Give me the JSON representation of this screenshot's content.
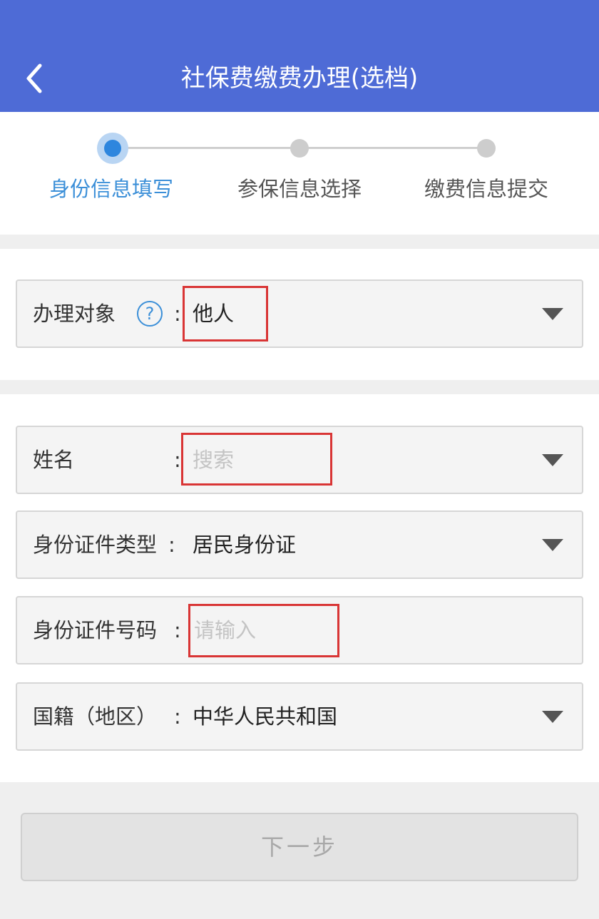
{
  "header": {
    "title": "社保费缴费办理(选档)",
    "back_icon": "chevron-left-icon",
    "background": "#4e6bd6"
  },
  "steps": [
    {
      "label": "身份信息填写",
      "active": true
    },
    {
      "label": "参保信息选择",
      "active": false
    },
    {
      "label": "缴费信息提交",
      "active": false
    }
  ],
  "form": {
    "target": {
      "label": "办理对象",
      "colon": ":",
      "value": "他人",
      "help_icon": "question-circle-icon"
    },
    "name": {
      "label": "姓名",
      "colon": ":",
      "placeholder": "搜索"
    },
    "id_type": {
      "label": "身份证件类型",
      "colon": ":",
      "value": "居民身份证"
    },
    "id_number": {
      "label": "身份证件号码",
      "colon": ":",
      "placeholder": "请输入"
    },
    "nationality": {
      "label": "国籍（地区）",
      "colon": ":",
      "value": "中华人民共和国"
    }
  },
  "next_button": {
    "label": "下一步"
  },
  "colors": {
    "accent": "#3b8fd8",
    "highlight_box": "#d93535"
  }
}
